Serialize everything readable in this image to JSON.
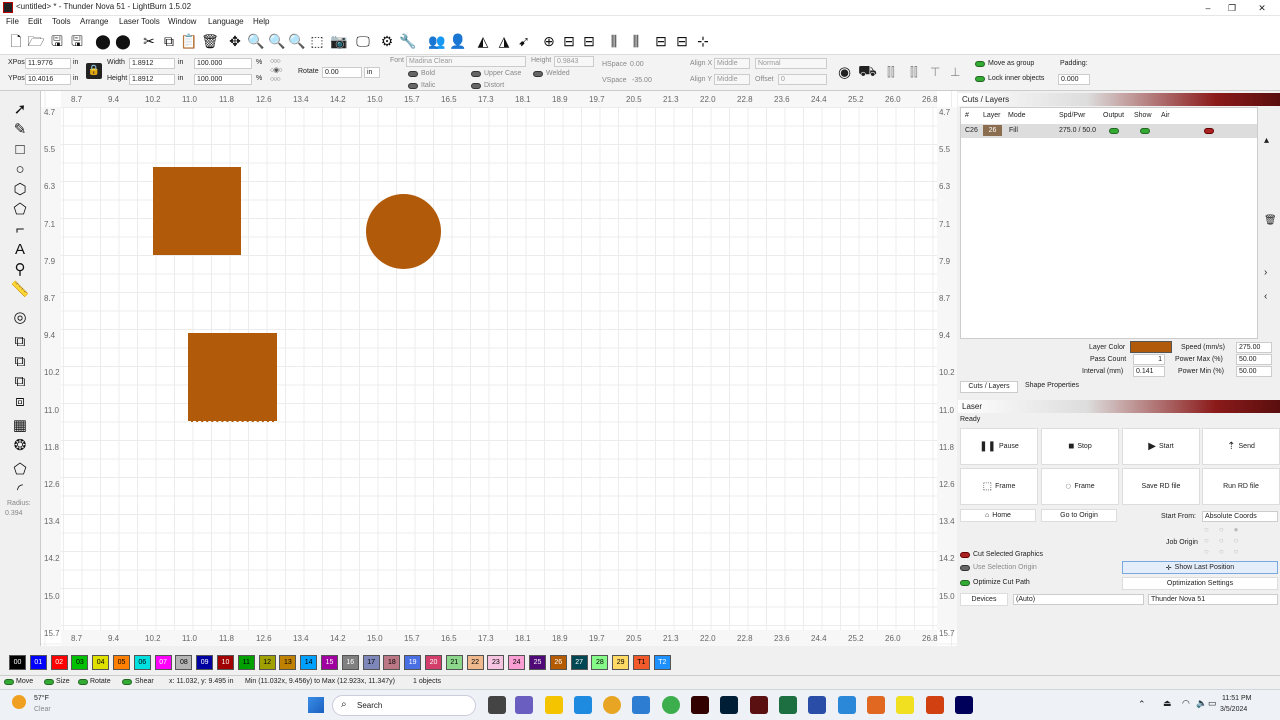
{
  "window": {
    "title": "<untitled> * - Thunder Nova 51 - LightBurn 1.5.02",
    "min": "–",
    "max": "❐",
    "close": "✕"
  },
  "menu": [
    "File",
    "Edit",
    "Tools",
    "Arrange",
    "Laser Tools",
    "Window",
    "Language",
    "Help"
  ],
  "props": {
    "xpos_label": "XPos",
    "xpos": "11.9776",
    "ypos_label": "YPos",
    "ypos": "10.4016",
    "unit": "in",
    "width_label": "Width",
    "width": "1.8912",
    "height_label": "Height",
    "height": "1.8912",
    "scale_w": "100.000",
    "scale_h": "100.000",
    "pct": "%",
    "rotate_label": "Rotate",
    "rotate": "0.00",
    "font_label": "Font",
    "font": "Madina Clean",
    "font_height_label": "Height",
    "font_height": "0.9843",
    "hspace_label": "HSpace",
    "hspace": "0.00",
    "vspace_label": "VSpace",
    "vspace": "-35.00",
    "alignx_label": "Align X",
    "alignx": "Middle",
    "aligny_label": "Align Y",
    "aligny": "Middle",
    "normal": "Normal",
    "offset_label": "Offset",
    "offset": "0",
    "bold": "Bold",
    "italic": "Italic",
    "upper_case": "Upper Case",
    "distort": "Distort",
    "welded": "Welded",
    "move_as_group": "Move as group",
    "lock_inner": "Lock inner objects",
    "padding_label": "Padding:",
    "padding": "0.000"
  },
  "ruler": {
    "x": [
      "8.7",
      "9.4",
      "10.2",
      "11.0",
      "11.8",
      "12.6",
      "13.4",
      "14.2",
      "15.0",
      "15.7",
      "16.5",
      "17.3",
      "18.1",
      "18.9",
      "19.7",
      "20.5",
      "21.3",
      "22.0",
      "22.8",
      "23.6",
      "24.4",
      "25.2",
      "26.0",
      "26.8"
    ],
    "y": [
      "4.7",
      "5.5",
      "6.3",
      "7.1",
      "7.9",
      "8.7",
      "9.4",
      "10.2",
      "11.0",
      "11.8",
      "12.6",
      "13.4",
      "14.2",
      "15.0",
      "15.7"
    ]
  },
  "left_tools": {
    "radius_label": "Radius:",
    "radius": "0.394"
  },
  "cuts": {
    "title": "Cuts / Layers",
    "cols": [
      "#",
      "Layer",
      "Mode",
      "Spd/Pwr",
      "Output",
      "Show",
      "Air"
    ],
    "row": {
      "id": "C26",
      "layer": "26",
      "mode": "Fill",
      "spdpwr": "275.0 / 50.0"
    },
    "layer_color_label": "Layer Color",
    "layer_color": "#b05a0a",
    "speed_label": "Speed (mm/s)",
    "speed": "275.00",
    "pass_label": "Pass Count",
    "pass": "1",
    "pmax_label": "Power Max (%)",
    "pmax": "50.00",
    "interval_label": "Interval (mm)",
    "interval": "0.141",
    "pmin_label": "Power Min (%)",
    "pmin": "50.00",
    "tab1": "Cuts / Layers",
    "tab2": "Shape Properties"
  },
  "laser": {
    "title": "Laser",
    "status": "Ready",
    "pause": "Pause",
    "stop": "Stop",
    "start": "Start",
    "send": "Send",
    "frame1": "Frame",
    "frame2": "Frame",
    "save_rd": "Save RD file",
    "run_rd": "Run RD file",
    "home": "Home",
    "goto_origin": "Go to Origin",
    "start_from_label": "Start From:",
    "start_from": "Absolute Coords",
    "job_origin": "Job Origin",
    "cut_selected": "Cut Selected Graphics",
    "use_sel_origin": "Use Selection Origin",
    "optimize_path": "Optimize Cut Path",
    "show_last": "Show Last Position",
    "opt_settings": "Optimization Settings",
    "devices": "Devices",
    "auto": "(Auto)",
    "device": "Thunder Nova 51"
  },
  "palette": [
    {
      "n": "00",
      "c": "#000000",
      "t": "#fff"
    },
    {
      "n": "01",
      "c": "#0000ff",
      "t": "#fff"
    },
    {
      "n": "02",
      "c": "#ff0000",
      "t": "#fff"
    },
    {
      "n": "03",
      "c": "#00c000",
      "t": "#000"
    },
    {
      "n": "04",
      "c": "#e0e000",
      "t": "#000"
    },
    {
      "n": "05",
      "c": "#ff8000",
      "t": "#000"
    },
    {
      "n": "06",
      "c": "#00e0e0",
      "t": "#000"
    },
    {
      "n": "07",
      "c": "#ff00ff",
      "t": "#fff"
    },
    {
      "n": "08",
      "c": "#b4b4b4",
      "t": "#000"
    },
    {
      "n": "09",
      "c": "#0000a0",
      "t": "#fff"
    },
    {
      "n": "10",
      "c": "#a00000",
      "t": "#fff"
    },
    {
      "n": "11",
      "c": "#00a000",
      "t": "#000"
    },
    {
      "n": "12",
      "c": "#a0a000",
      "t": "#000"
    },
    {
      "n": "13",
      "c": "#c08000",
      "t": "#000"
    },
    {
      "n": "14",
      "c": "#00a0ff",
      "t": "#000"
    },
    {
      "n": "15",
      "c": "#a000a0",
      "t": "#fff"
    },
    {
      "n": "16",
      "c": "#808080",
      "t": "#fff"
    },
    {
      "n": "17",
      "c": "#7d87b9",
      "t": "#000"
    },
    {
      "n": "18",
      "c": "#bb7784",
      "t": "#000"
    },
    {
      "n": "19",
      "c": "#4a6fe3",
      "t": "#fff"
    },
    {
      "n": "20",
      "c": "#d33f6a",
      "t": "#fff"
    },
    {
      "n": "21",
      "c": "#8cd78c",
      "t": "#000"
    },
    {
      "n": "22",
      "c": "#f0b98d",
      "t": "#000"
    },
    {
      "n": "23",
      "c": "#f6c4e1",
      "t": "#000"
    },
    {
      "n": "24",
      "c": "#fa9ed4",
      "t": "#000"
    },
    {
      "n": "25",
      "c": "#500a78",
      "t": "#fff"
    },
    {
      "n": "26",
      "c": "#b45a00",
      "t": "#fff"
    },
    {
      "n": "27",
      "c": "#004754",
      "t": "#fff"
    },
    {
      "n": "28",
      "c": "#86fa88",
      "t": "#000"
    },
    {
      "n": "29",
      "c": "#ffdb66",
      "t": "#000"
    },
    {
      "n": "T1",
      "c": "#f35a2b",
      "t": "#000"
    },
    {
      "n": "T2",
      "c": "#1e90ff",
      "t": "#fff"
    }
  ],
  "status": {
    "move": "Move",
    "size": "Size",
    "rotate": "Rotate",
    "shear": "Shear",
    "coords": "x: 11.032, y: 9.495 in",
    "range": "Min (11.032x, 9.456y) to Max (12.923x, 11.347y)",
    "objects": "1 objects"
  },
  "taskbar": {
    "temp": "57°F",
    "weather": "Clear",
    "search": "Search",
    "time": "11:51 PM",
    "date": "3/5/2024"
  }
}
